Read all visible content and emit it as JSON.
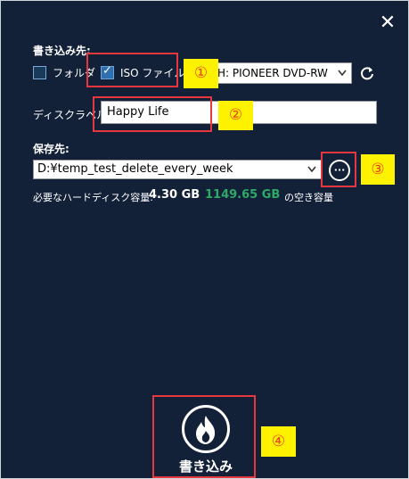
{
  "dialog": {
    "close_symbol": "✕"
  },
  "destination": {
    "label": "書き込み先:",
    "folder_option_label": "フォルダ",
    "iso_option_label": "ISO ファイル",
    "drive_select_value": "H: PIONEER  DVD-RW"
  },
  "disc_label": {
    "label": "ディスクラベル:",
    "value": "Happy Life"
  },
  "save_to": {
    "label": "保存先:",
    "path_value": "D:¥temp_test_delete_every_week",
    "browse_symbol": "···"
  },
  "required_space": {
    "label": "必要なハードディスク容量:",
    "required_value": "4.30 GB",
    "free_value": "1149.65 GB",
    "free_suffix": "の空き容量"
  },
  "burn_button": {
    "label": "書き込み"
  },
  "callouts": [
    "①",
    "②",
    "③",
    "④"
  ],
  "colors": {
    "background": "#132138",
    "free_space_green": "#2eaa66",
    "callout_red": "#e6383e",
    "callout_yellow": "#fff200"
  },
  "icons": [
    "close-icon",
    "refresh-icon",
    "chevron-down-icon",
    "ellipsis-icon",
    "flame-icon",
    "checkmark-icon"
  ]
}
